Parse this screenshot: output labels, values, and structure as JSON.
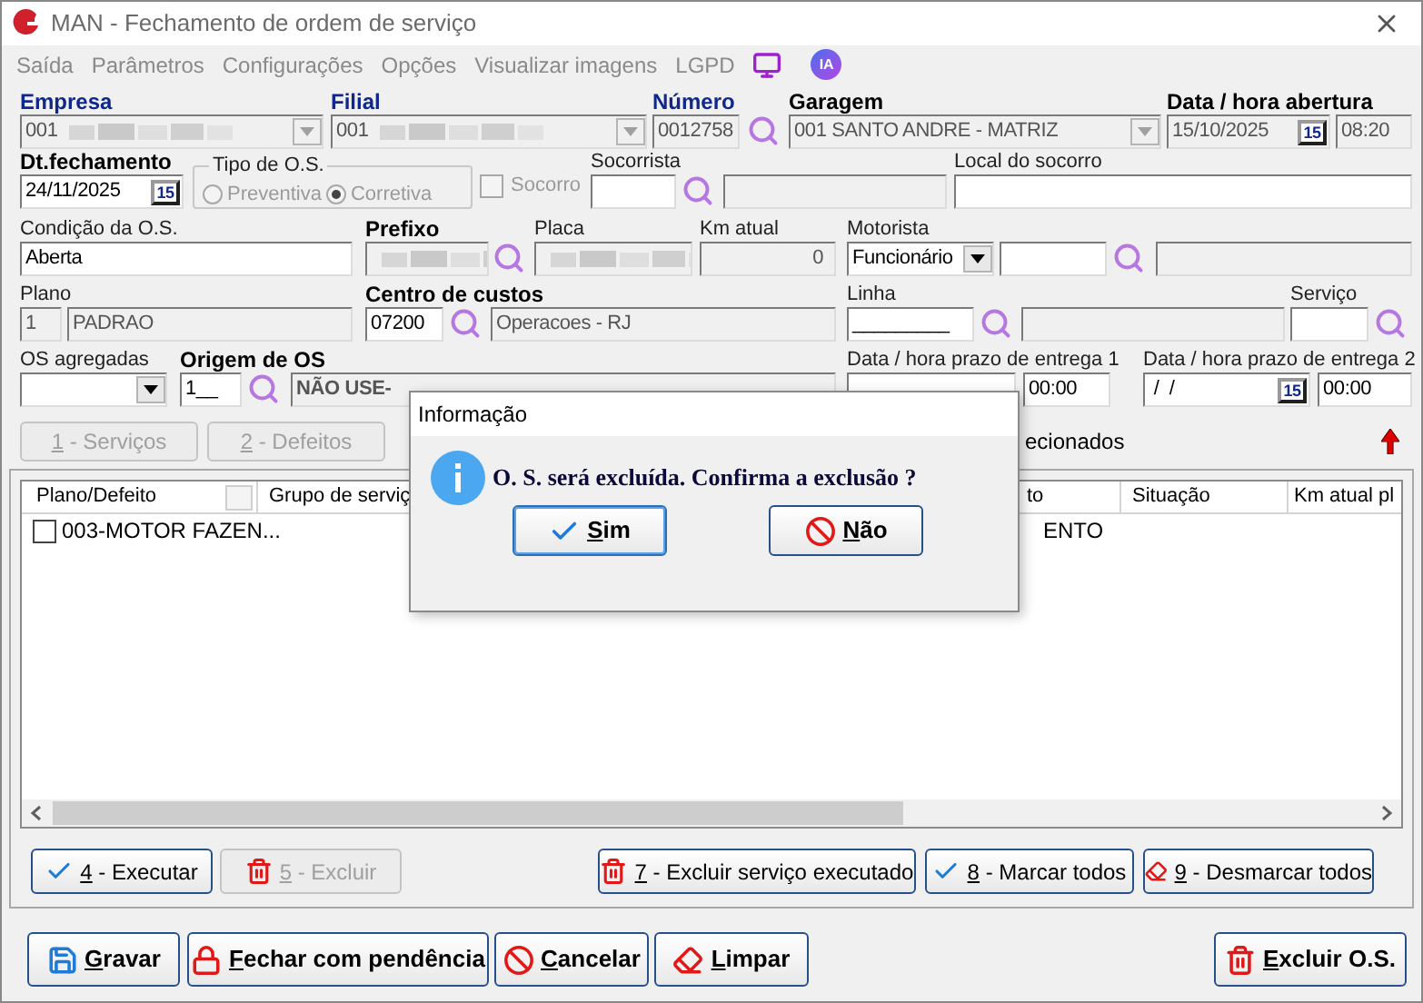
{
  "window": {
    "title": "MAN - Fechamento de ordem de serviço"
  },
  "menu": [
    {
      "label": "Saída"
    },
    {
      "label": "Parâmetros"
    },
    {
      "label": "Configurações"
    },
    {
      "label": "Opções"
    },
    {
      "label": "Visualizar imagens"
    },
    {
      "label": "LGPD"
    }
  ],
  "ai_badge": {
    "label": "IA"
  },
  "form_rows": [
    [
      {
        "kind": "combo",
        "label": "Empresa",
        "required": true,
        "label_bold": true,
        "value": "001",
        "enabled": false,
        "redacted": true
      },
      {
        "kind": "combo",
        "label": "Filial",
        "required": true,
        "label_bold": true,
        "value": "001",
        "enabled": false,
        "redacted": true
      },
      {
        "kind": "text",
        "label": "Número",
        "required": true,
        "label_bold": true,
        "value": "0012758",
        "enabled": false
      },
      {
        "kind": "search"
      },
      {
        "kind": "combo",
        "label": "Garagem",
        "required": false,
        "label_bold": true,
        "value": "001 SANTO ANDRE - MATRIZ",
        "enabled": false
      },
      {
        "kind": "date",
        "label": "Data / hora abertura",
        "required": false,
        "label_bold": true,
        "value": "15/10/2025",
        "icon_text": "15",
        "enabled": false
      },
      {
        "kind": "time",
        "value": "08:20",
        "enabled": false
      }
    ],
    [
      {
        "kind": "date",
        "label": "Dt.fechamento",
        "required": false,
        "label_bold": true,
        "value": "24/11/2025",
        "icon_text": "15",
        "enabled": true
      },
      {
        "kind": "radio_group",
        "label": "Tipo de O.S.",
        "enabled": false,
        "options": [
          {
            "label": "Preventiva",
            "selected": false
          },
          {
            "label": "Corretiva",
            "selected": true
          }
        ]
      },
      {
        "kind": "checkbox",
        "text": "Socorro",
        "checked": false,
        "enabled": false
      },
      {
        "kind": "text",
        "label": "Socorrista",
        "required": false,
        "label_bold": false,
        "enabled": true
      },
      {
        "kind": "search"
      },
      {
        "kind": "text",
        "enabled": false
      },
      {
        "kind": "text",
        "label": "Local do socorro",
        "required": false,
        "label_bold": false,
        "enabled": true
      }
    ],
    [
      {
        "kind": "text",
        "label": "Condição da O.S.",
        "required": false,
        "label_bold": false,
        "value": "Aberta",
        "enabled": true
      },
      {
        "kind": "text",
        "label": "Prefixo",
        "required": false,
        "label_bold": true,
        "enabled": false,
        "redacted": true
      },
      {
        "kind": "search"
      },
      {
        "kind": "text",
        "label": "Placa",
        "required": false,
        "label_bold": false,
        "enabled": false,
        "redacted": true
      },
      {
        "kind": "number",
        "label": "Km atual",
        "required": false,
        "label_bold": false,
        "value": "0",
        "enabled": false
      },
      {
        "kind": "combo",
        "label": "Motorista",
        "required": false,
        "label_bold": false,
        "value": "Funcionário",
        "enabled": true
      },
      {
        "kind": "text",
        "enabled": true
      },
      {
        "kind": "search"
      },
      {
        "kind": "text",
        "enabled": false
      }
    ],
    [
      {
        "kind": "text",
        "label": "Plano",
        "required": false,
        "label_bold": false,
        "value": "1",
        "enabled": false
      },
      {
        "kind": "text",
        "value": "PADRAO",
        "enabled": false
      },
      {
        "kind": "text",
        "label": "Centro de custos",
        "required": false,
        "label_bold": true,
        "value": "07200",
        "enabled": true
      },
      {
        "kind": "search"
      },
      {
        "kind": "text",
        "value": "Operacoes - RJ",
        "enabled": false
      },
      {
        "kind": "text",
        "label": "Linha",
        "required": false,
        "label_bold": false,
        "value": "_________",
        "enabled": true
      },
      {
        "kind": "search"
      },
      {
        "kind": "text",
        "enabled": false
      },
      {
        "kind": "text",
        "label": "Serviço",
        "required": false,
        "label_bold": false,
        "enabled": true
      },
      {
        "kind": "search"
      }
    ],
    [
      {
        "kind": "combo",
        "label": "OS agregadas",
        "required": false,
        "label_bold": false,
        "enabled": true
      },
      {
        "kind": "text",
        "label": "Origem de OS",
        "required": false,
        "label_bold": true,
        "value": "1__",
        "enabled": true
      },
      {
        "kind": "search"
      },
      {
        "kind": "text",
        "value": "NÃO USE-",
        "bold": true,
        "enabled": false
      },
      {
        "kind": "date",
        "label": "Data / hora prazo de entrega 1",
        "required": false,
        "label_bold": false,
        "enabled": true
      },
      {
        "kind": "time",
        "value": "00:00",
        "enabled": true
      },
      {
        "kind": "date",
        "label": "Data / hora prazo de entrega 2",
        "required": false,
        "label_bold": false,
        "value": " /  /",
        "icon_text": "15",
        "enabled": true
      },
      {
        "kind": "time",
        "value": "00:00",
        "enabled": true
      }
    ]
  ],
  "section_buttons": [
    {
      "hotkey": "1",
      "rest": " - Serviços",
      "enabled": false
    },
    {
      "hotkey": "2",
      "rest": " - Defeitos",
      "enabled": false
    }
  ],
  "selection_note": "ecionados",
  "grid": {
    "columns": [
      {
        "label": "Plano/Defeito",
        "kind": "menu"
      },
      {
        "label": "Grupo de serviç",
        "kind": "plain"
      },
      {
        "label": "to",
        "kind": "plain"
      },
      {
        "label": "Situação",
        "kind": "plain"
      },
      {
        "label": "Km atual pl",
        "kind": "plain"
      }
    ],
    "rows": [
      {
        "checked": false,
        "plano_defeito": "003-MOTOR FAZEN...",
        "column_3": "ENTO"
      }
    ]
  },
  "actions": [
    {
      "hotkey": "4",
      "rest": " - Executar",
      "kind": "check",
      "enabled": true
    },
    {
      "hotkey": "5",
      "rest": " - Excluir",
      "kind": "trash",
      "enabled": false
    },
    {
      "hotkey": "7",
      "rest": " - Excluir serviço executado",
      "kind": "trash",
      "enabled": true
    },
    {
      "hotkey": "8",
      "rest": " - Marcar todos",
      "kind": "check",
      "enabled": true
    },
    {
      "hotkey": "9",
      "rest": " - Desmarcar todos",
      "kind": "eraser",
      "enabled": true
    }
  ],
  "footer_buttons": [
    {
      "hotkey": "G",
      "rest": "ravar",
      "kind": "save",
      "enabled": true
    },
    {
      "hotkey": "F",
      "rest": "echar com pendência",
      "kind": "lock",
      "enabled": true
    },
    {
      "hotkey": "C",
      "rest": "ancelar",
      "kind": "ban",
      "enabled": true
    },
    {
      "hotkey": "L",
      "rest": "impar",
      "kind": "eraser",
      "enabled": true
    },
    {
      "hotkey": "E",
      "rest": "xcluir O.S.",
      "kind": "trash",
      "enabled": true
    }
  ],
  "dialog": {
    "title": "Informação",
    "message": "O. S. será excluída. Confirma a exclusão ?",
    "buttons": [
      {
        "hotkey": "S",
        "rest": "im",
        "kind": "check",
        "focused": true
      },
      {
        "hotkey": "N",
        "rest": "ão",
        "kind": "ban",
        "focused": false
      }
    ]
  }
}
